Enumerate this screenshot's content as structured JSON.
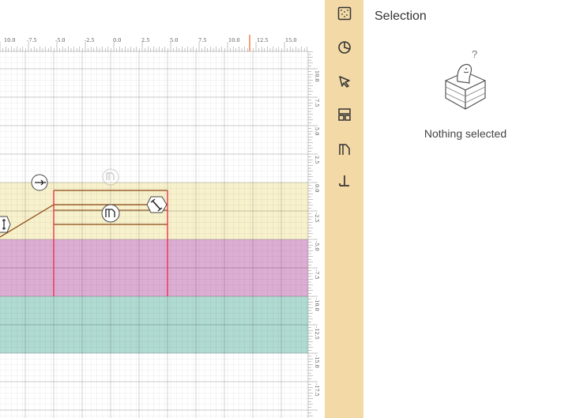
{
  "toolbar": {
    "tools": [
      {
        "name": "texture-icon"
      },
      {
        "name": "pie-icon"
      },
      {
        "name": "select-cursor-icon"
      },
      {
        "name": "layout-icon"
      },
      {
        "name": "foundation-icon"
      },
      {
        "name": "anchor-icon"
      }
    ]
  },
  "panel": {
    "title": "Selection",
    "empty_text": "Nothing selected"
  },
  "ruler": {
    "top_labels": [
      "10.0",
      "-7.5",
      "-5.0",
      "-2.5",
      "0.0",
      "2.5",
      "5.0",
      "7.5",
      "10.0",
      "12.5",
      "15.0"
    ],
    "right_labels": [
      "10.0",
      "7.5",
      "5.0",
      "2.5",
      "0.0",
      "-2.5",
      "-5.0",
      "-7.5",
      "-10.0",
      "-12.5",
      "-15.0",
      "-17.5"
    ]
  },
  "colors": {
    "toolbar_bg": "#f2d9a6",
    "layer_top": "#f7f1cc",
    "layer_middle": "#ddaed4",
    "layer_bottom": "#b0dbd2",
    "marker": "#e8334a",
    "structure": "#8b4513"
  }
}
